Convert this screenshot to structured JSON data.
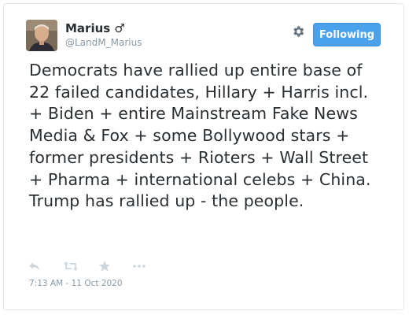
{
  "tweet": {
    "author": {
      "display_name": "Marius ♂",
      "handle": "@LandM_Marius"
    },
    "follow_label": "Following",
    "text": "Democrats have rallied up entire base of 22 failed candidates, Hillary + Harris incl. + Biden + entire Mainstream Fake News Media & Fox + some Bollywood stars + former presidents + Rioters + Wall Street + Pharma + international celebs + China. Trump has rallied up - the people.",
    "timestamp": "7:13 AM - 11 Oct 2020"
  },
  "icons": {
    "settings": "gear-icon",
    "reply": "reply-icon",
    "retweet": "retweet-icon",
    "like": "star-icon",
    "more": "more-icon"
  },
  "colors": {
    "follow_button": "#4aa1ec",
    "text": "#292f33",
    "muted": "#8899a6",
    "action_icons": "#ccd6dd"
  }
}
